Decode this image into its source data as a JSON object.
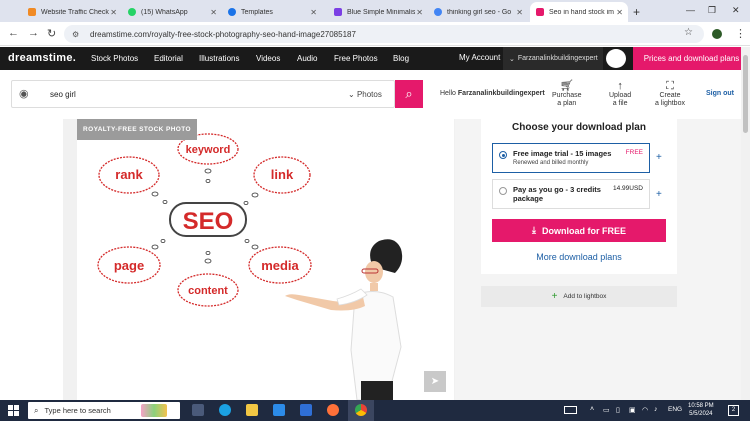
{
  "browser": {
    "tabs": [
      {
        "title": "Website Traffic Check",
        "color": "#f08a24"
      },
      {
        "title": "(15) WhatsApp",
        "color": "#25d366"
      },
      {
        "title": "Templates",
        "color": "#1a73e8"
      },
      {
        "title": "Blue Simple Minimalis",
        "color": "#7b3fe4"
      },
      {
        "title": "thinking girl seo - Go",
        "color": "#4285f4"
      },
      {
        "title": "Seo in hand stock im",
        "color": "#e5196b"
      }
    ],
    "active_tab_index": 5,
    "new_tab": "+",
    "url": "dreamstime.com/royalty-free-stock-photography-seo-hand-image27085187"
  },
  "site_nav": {
    "logo": "dreamstime.",
    "items": [
      "Stock Photos",
      "Editorial",
      "Illustrations",
      "Videos",
      "Audio",
      "Free Photos",
      "Blog"
    ],
    "my_account": "My Account",
    "username": "Farzanalinkbuildingexpert",
    "prices_button": "Prices and download plans"
  },
  "search": {
    "query": "seo girl",
    "category": "Photos"
  },
  "account_bar": {
    "hello_prefix": "Hello",
    "username": "Farzanalinkbuildingexpert",
    "purchase": [
      "Purchase",
      "a plan"
    ],
    "upload": [
      "Upload",
      "a file"
    ],
    "lightbox": [
      "Create",
      "a lightbox"
    ],
    "sign_out": "Sign out"
  },
  "image": {
    "badge": "ROYALTY-FREE STOCK PHOTO",
    "bubbles": [
      "keyword",
      "rank",
      "link",
      "SEO",
      "page",
      "media",
      "content"
    ]
  },
  "download_plan": {
    "title": "Choose your download plan",
    "options": [
      {
        "label": "Free image trial - 15 images",
        "sub": "Renewed and billed monthly",
        "price": "FREE",
        "selected": true
      },
      {
        "label": "Pay as you go - 3 credits package",
        "sub": "",
        "price": "14.99USD",
        "selected": false
      }
    ],
    "download_button": "Download for FREE",
    "more_plans": "More download plans",
    "add_to_lightbox": "Add to lightbox"
  },
  "taskbar": {
    "search_placeholder": "Type here to search",
    "language": "ENG",
    "time": "10:58 PM",
    "date": "5/5/2024",
    "notifications": "2"
  },
  "colors": {
    "brand": "#e5196b",
    "link": "#1d5fa5",
    "nav_bg": "#1a1a1a",
    "bubble_red": "#d42a2a"
  }
}
